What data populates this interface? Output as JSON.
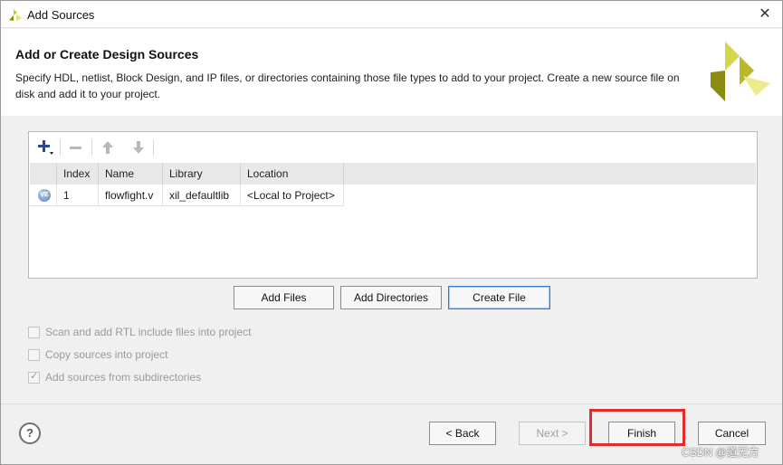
{
  "window": {
    "title": "Add Sources",
    "close_glyph": "✕"
  },
  "header": {
    "heading": "Add or Create Design Sources",
    "description": "Specify HDL, netlist, Block Design, and IP files, or directories containing those file types to add to your project. Create a new source file on disk and add it to your project."
  },
  "toolbar": {
    "icons": [
      "add-icon",
      "remove-icon",
      "move-up-icon",
      "move-down-icon"
    ]
  },
  "table": {
    "columns": [
      "Index",
      "Name",
      "Library",
      "Location"
    ],
    "rows": [
      {
        "icon": "verilog-file-icon",
        "index": "1",
        "name": "flowfight.v",
        "library": "xil_defaultlib",
        "location": "<Local to Project>"
      }
    ]
  },
  "actions": {
    "add_files": "Add Files",
    "add_directories": "Add Directories",
    "create_file": "Create File"
  },
  "options": [
    {
      "label": "Scan and add RTL include files into project",
      "checked": false
    },
    {
      "label": "Copy sources into project",
      "checked": false
    },
    {
      "label": "Add sources from subdirectories",
      "checked": true
    }
  ],
  "footer": {
    "help": "?",
    "back": "< Back",
    "next": "Next >",
    "finish": "Finish",
    "cancel": "Cancel"
  },
  "annotation": {
    "highlight_color": "#e42a2a"
  },
  "watermark": "CSDN @道无方"
}
